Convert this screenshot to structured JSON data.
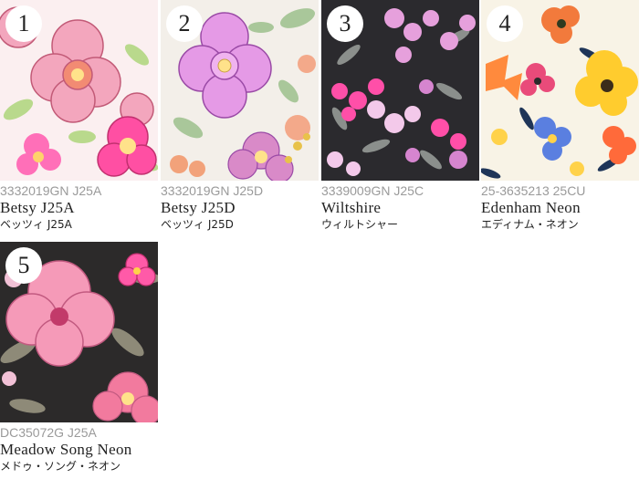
{
  "products": [
    {
      "number": "1",
      "code": "3332019GN J25A",
      "name": "Betsy J25A",
      "name_jp": "ベッツィ J25A",
      "pattern": "betsy-pink"
    },
    {
      "number": "2",
      "code": "3332019GN J25D",
      "name": "Betsy J25D",
      "name_jp": "ベッツィ J25D",
      "pattern": "betsy-lilac"
    },
    {
      "number": "3",
      "code": "3339009GN J25C",
      "name": "Wiltshire",
      "name_jp": "ウィルトシャー",
      "pattern": "wiltshire-berries"
    },
    {
      "number": "4",
      "code": "25-3635213 25CU",
      "name": "Edenham Neon",
      "name_jp": "エディナム・ネオン",
      "pattern": "edenham-floral"
    },
    {
      "number": "5",
      "code": "DC35072G J25A",
      "name": "Meadow Song Neon",
      "name_jp": "メドゥ・ソング・ネオン",
      "pattern": "meadow-poppy"
    }
  ]
}
